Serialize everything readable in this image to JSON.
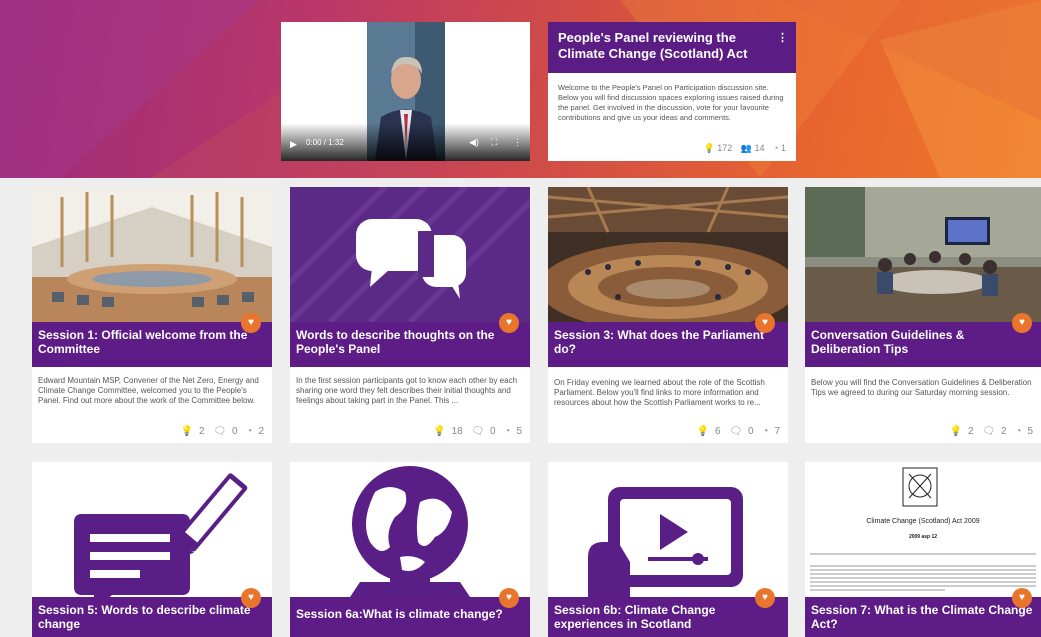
{
  "video": {
    "time": "0:00 / 1:32",
    "play_icon": "play-icon",
    "volume_icon": "volume-icon",
    "fullscreen_icon": "fullscreen-icon",
    "more_icon": "kebab-icon"
  },
  "panel": {
    "title": "People's Panel reviewing the Climate Change (Scotland) Act",
    "menu_glyph": "⋮",
    "description": "Welcome to the People's Panel on Participation discussion site. Below you will find discussion spaces exploring issues raised during the panel. Get involved in the discussion, vote for your favourite contributions and give us your ideas and comments.",
    "ideas": "172",
    "members": "14",
    "sessions": "1"
  },
  "cards": [
    {
      "title": "Session 1: Official welcome from the Committee",
      "description": "Edward Mountain MSP, Convener of the Net Zero, Energy and Climate Change Committee, welcomed you to the People's Panel. Find out more about the work of the Committee below.",
      "ideas": "2",
      "comments": "0",
      "sessions": "2"
    },
    {
      "title": "Words to describe thoughts on the People's Panel",
      "description": "In the first session participants got to know each other by each sharing one word they felt describes their initial thoughts and feelings about taking part in the Panel. This ...",
      "ideas": "18",
      "comments": "0",
      "sessions": "5"
    },
    {
      "title": "Session 3: What does the Parliament do?",
      "description": "On Friday evening we learned about the role of the Scottish Parliament. Below you'll find links to more information and resources about how the Scottish Parliament works to re...",
      "ideas": "6",
      "comments": "0",
      "sessions": "7"
    },
    {
      "title": "Conversation Guidelines & Deliberation Tips",
      "description": "Below you will find the Conversation Guidelines & Deliberation Tips we agreed to during our Saturday morning session.",
      "ideas": "2",
      "comments": "2",
      "sessions": "5"
    },
    {
      "title": "Session 5: Words to describe climate change"
    },
    {
      "title": "Session 6a:What is climate change?"
    },
    {
      "title": "Session 6b: Climate Change experiences in Scotland"
    },
    {
      "title": "Session 7: What is the Climate Change Act?"
    }
  ],
  "act_doc": {
    "title": "Climate Change (Scotland) Act 2009",
    "asp": "2009 asp 12"
  },
  "icons": {
    "idea": "lightbulb-icon",
    "comment": "comment-icon",
    "session": "session-icon",
    "favourite": "heart-icon"
  },
  "colors": {
    "purple": "#5e1c86",
    "orange": "#e8752b"
  }
}
